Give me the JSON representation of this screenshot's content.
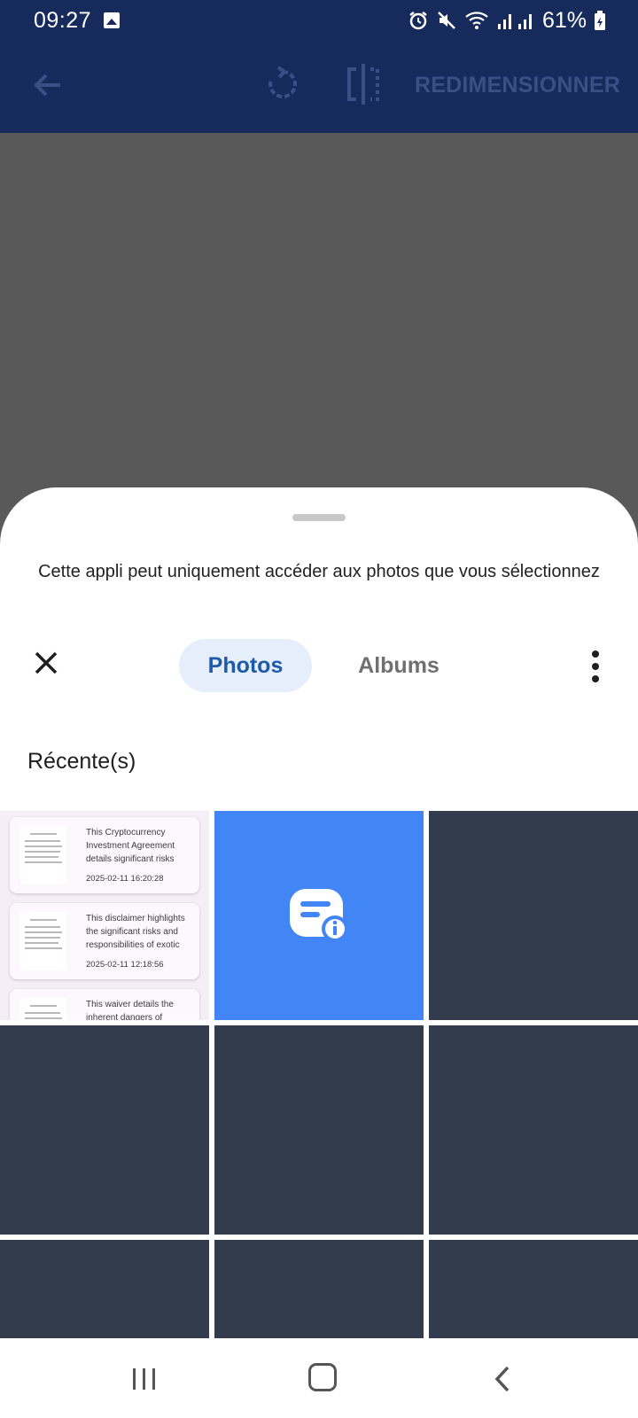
{
  "status_bar": {
    "time": "09:27",
    "battery": "61%"
  },
  "toolbar": {
    "resize_label": "REDIMENSIONNER"
  },
  "sheet": {
    "notice": "Cette appli peut uniquement accéder aux photos que vous sélectionnez",
    "tabs": [
      {
        "label": "Photos",
        "selected": true
      },
      {
        "label": "Albums",
        "selected": false
      }
    ],
    "section_title": "Récente(s)"
  },
  "recent_docs": [
    {
      "text": "This Cryptocurrency Investment Agreement details significant risks",
      "date": "2025-02-11 16:20:28"
    },
    {
      "text": "This disclaimer highlights the significant risks and responsibilities of exotic",
      "date": "2025-02-11 12:18:56"
    },
    {
      "text": "This waiver details the inherent dangers of",
      "date": ""
    }
  ],
  "colors": {
    "header": "#162a5c",
    "accent_tab_bg": "#e6eefb",
    "accent_tab_text": "#1d5aa7",
    "app_tile": "#4285f4",
    "placeholder_tile": "#333c4d"
  },
  "icons": [
    "gallery-icon",
    "alarm-icon",
    "mute-icon",
    "wifi-icon",
    "signal-icon",
    "battery-icon",
    "back-arrow-icon",
    "rotate-icon",
    "flip-icon",
    "close-icon",
    "more-vert-icon",
    "message-info-icon",
    "nav-recent-icon",
    "nav-home-icon",
    "nav-back-icon"
  ]
}
